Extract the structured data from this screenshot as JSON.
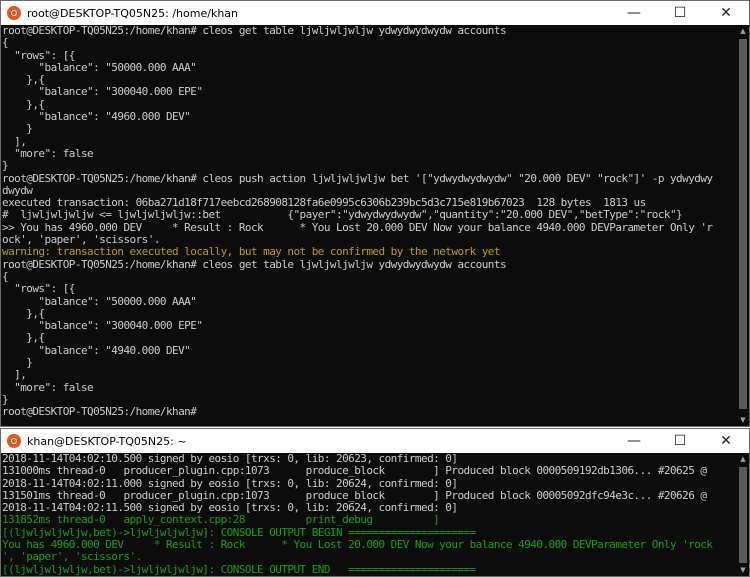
{
  "window1": {
    "title": "root@DESKTOP-TQ05N25: /home/khan",
    "controls": {
      "minimize": "—",
      "maximize": "☐",
      "close": "✕"
    },
    "lines": [
      {
        "text": "root@DESKTOP-TQ05N25:/home/khan# cleos get table ljwljwljwljw ydwydwydwydw accounts",
        "color": "#cccccc"
      },
      {
        "text": "{",
        "color": "#cccccc"
      },
      {
        "text": "  \"rows\": [{",
        "color": "#cccccc"
      },
      {
        "text": "      \"balance\": \"50000.000 AAA\"",
        "color": "#cccccc"
      },
      {
        "text": "    },{",
        "color": "#cccccc"
      },
      {
        "text": "      \"balance\": \"300040.000 EPE\"",
        "color": "#cccccc"
      },
      {
        "text": "    },{",
        "color": "#cccccc"
      },
      {
        "text": "      \"balance\": \"4960.000 DEV\"",
        "color": "#cccccc"
      },
      {
        "text": "    }",
        "color": "#cccccc"
      },
      {
        "text": "  ],",
        "color": "#cccccc"
      },
      {
        "text": "  \"more\": false",
        "color": "#cccccc"
      },
      {
        "text": "}",
        "color": "#cccccc"
      },
      {
        "text": "root@DESKTOP-TQ05N25:/home/khan# cleos push action ljwljwljwljw bet '[\"ydwydwydwydw\" \"20.000 DEV\" \"rock\"]' -p ydwydwy",
        "color": "#cccccc"
      },
      {
        "text": "dwydw",
        "color": "#cccccc"
      },
      {
        "text": "executed transaction: 06ba271d18f717eebcd268908128fa6e0995c6306b239bc5d3c715e819b67023  128 bytes  1813 us",
        "color": "#cccccc"
      },
      {
        "text": "#  ljwljwljwljw <= ljwljwljwljw::bet           {\"payer\":\"ydwydwydwydw\",\"quantity\":\"20.000 DEV\",\"betType\":\"rock\"}",
        "color": "#cccccc"
      },
      {
        "text": ">> You has 4960.000 DEV     * Result : Rock      * You Lost 20.000 DEV Now your balance 4940.000 DEVParameter Only 'r",
        "color": "#cccccc"
      },
      {
        "text": "ock', 'paper', 'scissors'.",
        "color": "#cccccc"
      },
      {
        "text": "warning: transaction executed locally, but may not be confirmed by the network yet",
        "color": "#c19c00"
      },
      {
        "text": "root@DESKTOP-TQ05N25:/home/khan# cleos get table ljwljwljwljw ydwydwydwydw accounts",
        "color": "#cccccc"
      },
      {
        "text": "{",
        "color": "#cccccc"
      },
      {
        "text": "  \"rows\": [{",
        "color": "#cccccc"
      },
      {
        "text": "      \"balance\": \"50000.000 AAA\"",
        "color": "#cccccc"
      },
      {
        "text": "    },{",
        "color": "#cccccc"
      },
      {
        "text": "      \"balance\": \"300040.000 EPE\"",
        "color": "#cccccc"
      },
      {
        "text": "    },{",
        "color": "#cccccc"
      },
      {
        "text": "      \"balance\": \"4940.000 DEV\"",
        "color": "#cccccc"
      },
      {
        "text": "    }",
        "color": "#cccccc"
      },
      {
        "text": "  ],",
        "color": "#cccccc"
      },
      {
        "text": "  \"more\": false",
        "color": "#cccccc"
      },
      {
        "text": "}",
        "color": "#cccccc"
      },
      {
        "text": "root@DESKTOP-TQ05N25:/home/khan#",
        "color": "#cccccc"
      }
    ]
  },
  "window2": {
    "title": "khan@DESKTOP-TQ05N25: ~",
    "controls": {
      "minimize": "—",
      "maximize": "☐",
      "close": "✕"
    },
    "lines": [
      {
        "text": "2018-11-14T04:02:10.500 signed by eosio [trxs: 0, lib: 20623, confirmed: 0]",
        "color": "#cccccc"
      },
      {
        "text": "131000ms thread-0   producer_plugin.cpp:1073      produce_block        ] Produced block 0000509192db1306... #20625 @",
        "color": "#cccccc"
      },
      {
        "text": "2018-11-14T04:02:11.000 signed by eosio [trxs: 0, lib: 20624, confirmed: 0]",
        "color": "#cccccc"
      },
      {
        "text": "131501ms thread-0   producer_plugin.cpp:1073      produce_block        ] Produced block 00005092dfc94e3c... #20626 @",
        "color": "#cccccc"
      },
      {
        "text": "2018-11-14T04:02:11.500 signed by eosio [trxs: 0, lib: 20624, confirmed: 0]",
        "color": "#cccccc"
      },
      {
        "text": "131852ms thread-0   apply_context.cpp:28          print_debug          ]",
        "color": "#13a10e"
      },
      {
        "text": "[(ljwljwljwljw,bet)->ljwljwljwljw]: CONSOLE OUTPUT BEGIN =====================",
        "color": "#13a10e"
      },
      {
        "text": "You has 4960.000 DEV     * Result : Rock      * You Lost 20.000 DEV Now your balance 4940.000 DEVParameter Only 'rock",
        "color": "#13a10e"
      },
      {
        "text": "', 'paper', 'scissors'.",
        "color": "#13a10e"
      },
      {
        "text": "[(ljwljwljwljw,bet)->ljwljwljwljw]: CONSOLE OUTPUT END   =====================",
        "color": "#13a10e"
      }
    ]
  }
}
